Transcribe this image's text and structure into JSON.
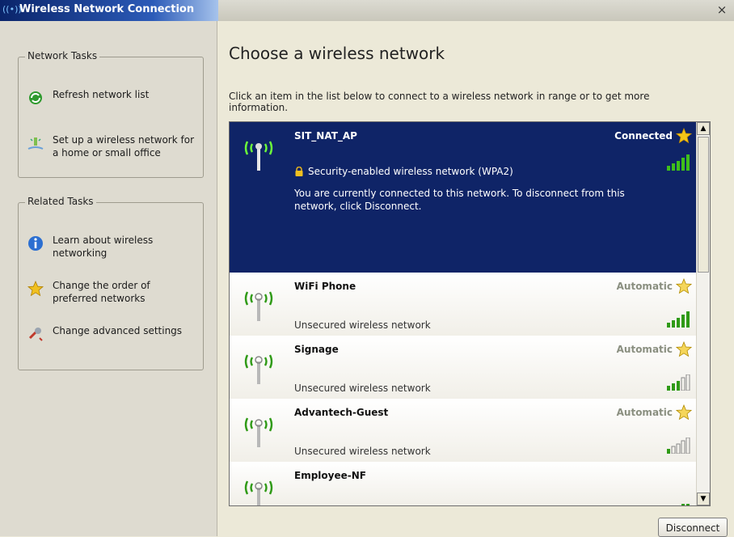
{
  "window": {
    "title": "Wireless Network Connection",
    "close_label": "×"
  },
  "network_tasks": {
    "title": "Network Tasks",
    "items": [
      {
        "label": "Refresh network list",
        "icon": "refresh-icon"
      },
      {
        "label": "Set up a wireless network for a home or small office",
        "icon": "wireless-setup-icon"
      }
    ]
  },
  "related_tasks": {
    "title": "Related Tasks",
    "items": [
      {
        "label": "Learn about wireless networking",
        "icon": "info-icon"
      },
      {
        "label": "Change the order of preferred networks",
        "icon": "star-icon"
      },
      {
        "label": "Change advanced settings",
        "icon": "settings-icon"
      }
    ]
  },
  "main": {
    "title": "Choose a wireless network",
    "description": "Click an item in the list below to connect to a wireless network in range or to get more information."
  },
  "networks": [
    {
      "name": "SIT_NAT_AP",
      "status": "Connected",
      "security": "Security-enabled wireless network (WPA2)",
      "info": "You are currently connected to this network. To disconnect from this network, click Disconnect.",
      "signal_bars": 5,
      "selected": true
    },
    {
      "name": "WiFi Phone",
      "status": "Automatic",
      "security": "Unsecured wireless network",
      "signal_bars": 5,
      "selected": false
    },
    {
      "name": "Signage",
      "status": "Automatic",
      "security": "Unsecured wireless network",
      "signal_bars": 3,
      "selected": false
    },
    {
      "name": "Advantech-Guest",
      "status": "Automatic",
      "security": "Unsecured wireless network",
      "signal_bars": 1,
      "selected": false
    },
    {
      "name": "Employee-NF",
      "status": "",
      "security": "",
      "signal_bars": 1,
      "selected": false
    }
  ],
  "buttons": {
    "disconnect": "Disconnect"
  },
  "colors": {
    "selected_bg": "#0f2467",
    "signal_green": "#2f9a16",
    "star_gold": "#f0c020"
  }
}
